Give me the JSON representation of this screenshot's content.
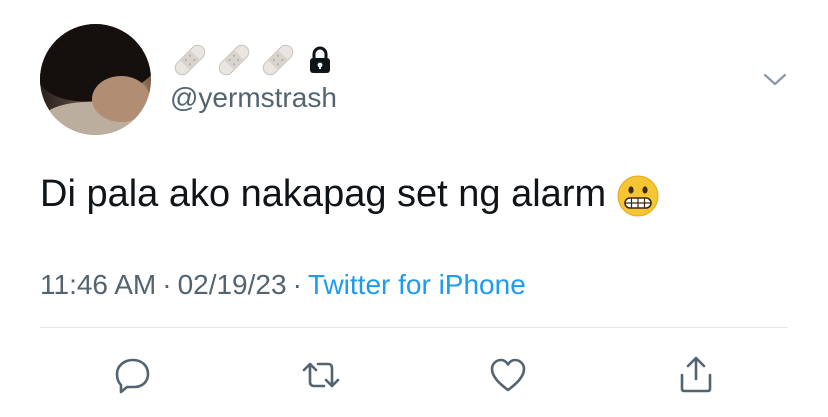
{
  "tweet": {
    "handle": "@yermstrash",
    "text": "Di pala ako nakapag set ng alarm",
    "time": "11:46 AM",
    "date": "02/19/23",
    "separator": "·",
    "source": "Twitter for iPhone"
  },
  "icons": {
    "display_name": [
      "bandage-emoji",
      "bandage-emoji",
      "bandage-emoji"
    ],
    "protected": "lock-icon",
    "more": "chevron-down-icon",
    "text_emoji": "grimacing-face-emoji",
    "actions": [
      "reply-icon",
      "retweet-icon",
      "like-icon",
      "share-icon"
    ]
  },
  "colors": {
    "text": "#0f1419",
    "secondary": "#536471",
    "link": "#1d9bf0",
    "divider": "#e3e7ea",
    "icon": "#536471"
  }
}
